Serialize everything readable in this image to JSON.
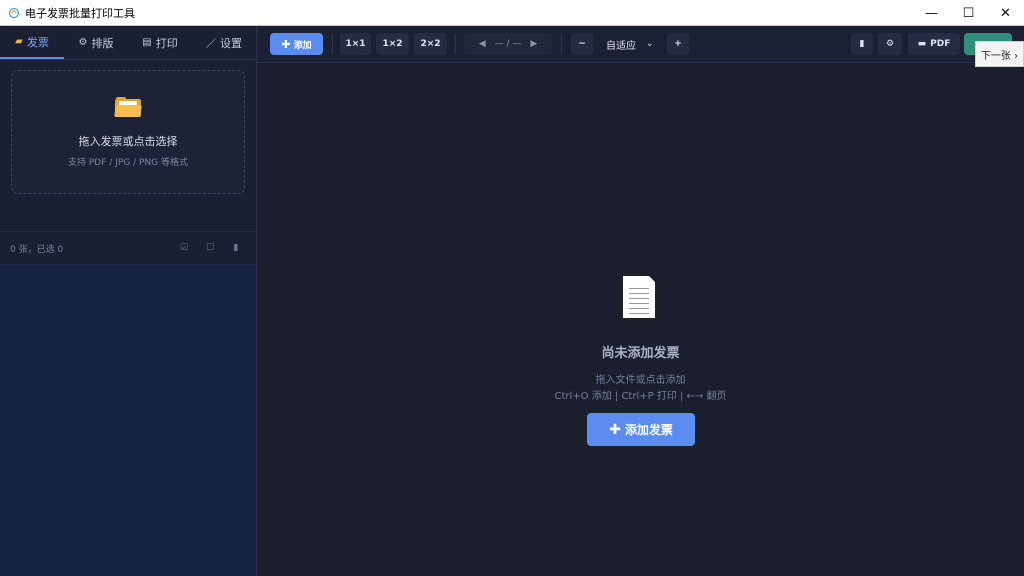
{
  "window": {
    "title": "电子发票批量打印工具",
    "minimize": "—",
    "maximize": "☐",
    "close": "✕"
  },
  "sidebar": {
    "tabs": [
      {
        "label": "发票",
        "icon": "folder-icon",
        "active": true
      },
      {
        "label": "排版",
        "icon": "gear-icon",
        "active": false
      },
      {
        "label": "打印",
        "icon": "printer-icon",
        "active": false
      },
      {
        "label": "设置",
        "icon": "pen-icon",
        "active": false
      }
    ],
    "dropzone": {
      "title": "拖入发票或点击选择",
      "subtitle": "支持 PDF / JPG / PNG 等格式"
    },
    "listbar": {
      "count_text": "0 张，已选 0"
    }
  },
  "toolbar": {
    "add_label": "添加",
    "layouts": [
      "1×1",
      "1×2",
      "2×2"
    ],
    "page_indicator": "— / —",
    "zoom_value": "自适应",
    "zoom_minus": "−",
    "zoom_plus": "+",
    "pdf_label": "PDF"
  },
  "main": {
    "empty_title": "尚未添加发票",
    "empty_hint1": "拖入文件或点击添加",
    "empty_hint2": "Ctrl+O 添加 | Ctrl+P 打印 | ←→ 翻页",
    "add_button": "添加发票"
  },
  "tooltip": {
    "next_page": "下一张 ›"
  },
  "colors": {
    "accent": "#5b8cf0",
    "bg": "#1b1e2d",
    "sidebar": "#162242",
    "print_btn": "#2f8f7a"
  }
}
